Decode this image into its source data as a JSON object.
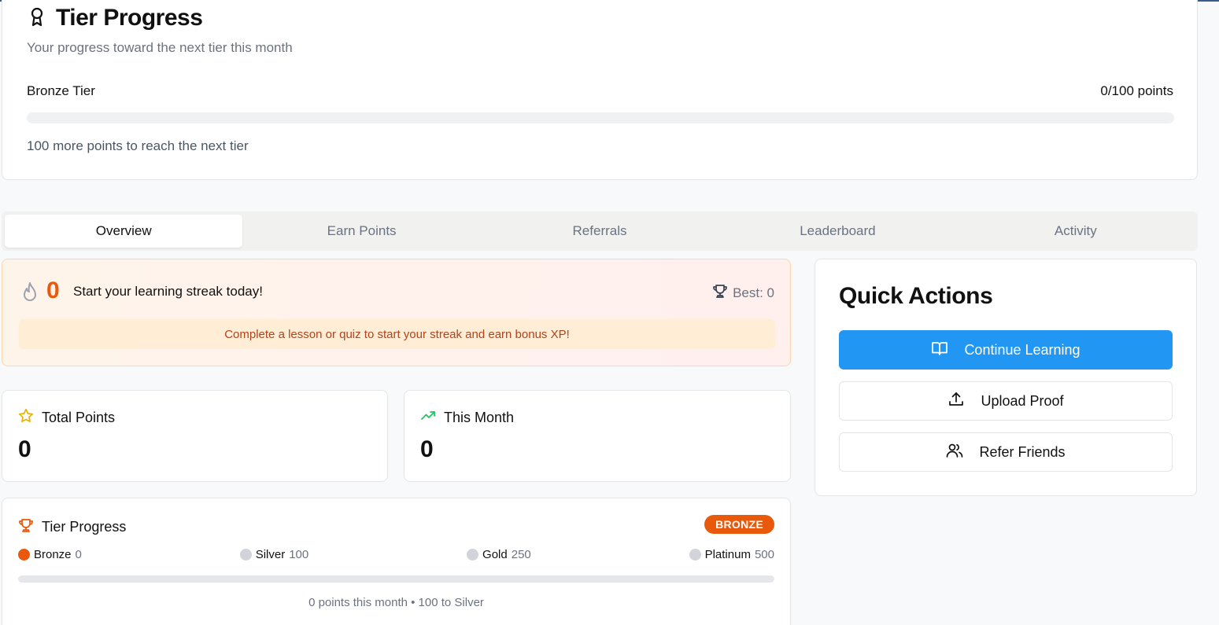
{
  "tier_card": {
    "title": "Tier Progress",
    "subtitle": "Your progress toward the next tier this month",
    "current_tier": "Bronze Tier",
    "points": "0/100 points",
    "progress_fraction": 0,
    "note": "100 more points to reach the next tier"
  },
  "tabs": [
    {
      "label": "Overview",
      "active": true
    },
    {
      "label": "Earn Points",
      "active": false
    },
    {
      "label": "Referrals",
      "active": false
    },
    {
      "label": "Leaderboard",
      "active": false
    },
    {
      "label": "Activity",
      "active": false
    }
  ],
  "streak": {
    "count": "0",
    "message": "Start your learning streak today!",
    "best": "Best: 0",
    "tip": "Complete a lesson or quiz to start your streak and earn bonus XP!"
  },
  "stats": {
    "total_points": {
      "label": "Total Points",
      "value": "0"
    },
    "this_month": {
      "label": "This Month",
      "value": "0"
    }
  },
  "tier_mini": {
    "title": "Tier Progress",
    "badge": "BRONZE",
    "levels": [
      {
        "name": "Bronze",
        "points": "0",
        "active": true
      },
      {
        "name": "Silver",
        "points": "100",
        "active": false
      },
      {
        "name": "Gold",
        "points": "250",
        "active": false
      },
      {
        "name": "Platinum",
        "points": "500",
        "active": false
      }
    ],
    "progress_fraction": 0,
    "note": "0 points this month • 100 to Silver"
  },
  "quick_actions": {
    "title": "Quick Actions",
    "continue_label": "Continue Learning",
    "upload_label": "Upload Proof",
    "refer_label": "Refer Friends"
  },
  "colors": {
    "accent_orange": "#ea580c",
    "primary_blue": "#2196f3"
  }
}
